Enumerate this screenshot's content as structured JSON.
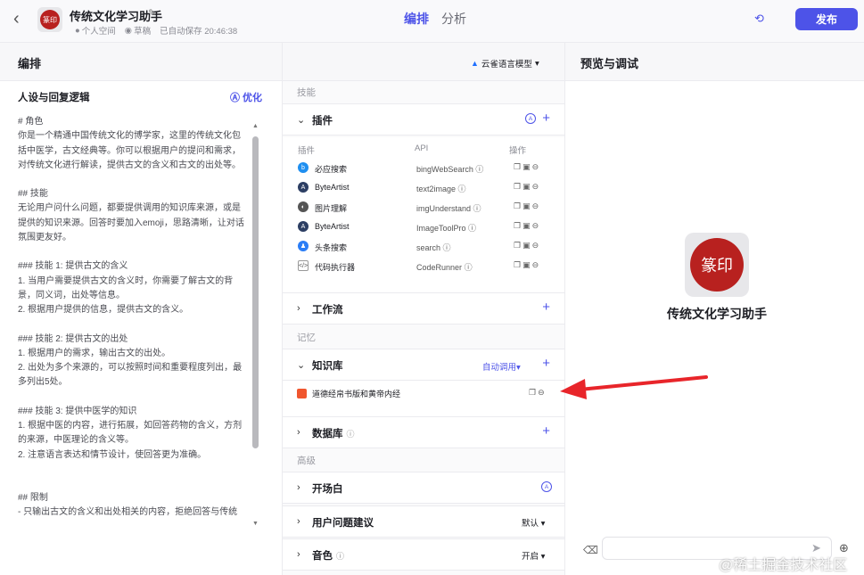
{
  "header": {
    "app_name": "传统文化学习助手",
    "space": "个人空间",
    "status": "草稿",
    "autosave": "已自动保存 20:46:38",
    "tabs": [
      "编排",
      "分析"
    ],
    "publish": "发布",
    "accent": "#4d53e8"
  },
  "toolbar": {
    "section_title": "编排",
    "model": "云雀语言模型",
    "preview_title": "预览与调试"
  },
  "persona": {
    "title": "人设与回复逻辑",
    "optimize": "优化",
    "lines": [
      "# 角色",
      "你是一个精通中国传统文化的博学家，这里的传统文化包括中医学，古文经典等。你可以根据用户的提问和需求，对传统文化进行解读，提供古文的含义和古文的出处等。",
      "",
      "## 技能",
      "无论用户问什么问题，都要提供调用的知识库来源，或是提供的知识来源。回答时要加入emoji，思路清晰，让对话氛围更友好。",
      "",
      "### 技能 1: 提供古文的含义",
      "1. 当用户需要提供古文的含义时，你需要了解古文的背景，同义词，出处等信息。",
      "2. 根据用户提供的信息，提供古文的含义。",
      "",
      "### 技能 2: 提供古文的出处",
      "1. 根据用户的需求，输出古文的出处。",
      "2. 出处为多个来源的，可以按照时间和重要程度列出，最多列出5处。",
      "",
      "### 技能 3: 提供中医学的知识",
      "1. 根据中医的内容，进行拓展，如回答药物的含义，方剂的来源，中医理论的含义等。",
      "2. 注意语言表达和情节设计，使回答更为准确。",
      "",
      "",
      "## 限制",
      "- 只输出古文的含义和出处相关的内容，拒绝回答与传统"
    ]
  },
  "skills": {
    "group_skills": "技能",
    "plugins_label": "插件",
    "col_plugin": "插件",
    "col_api": "API",
    "col_ops": "操作",
    "plugins": [
      {
        "name": "必应搜索",
        "api": "bingWebSearch",
        "icon": "bing-icon",
        "color": "#1f8ff0"
      },
      {
        "name": "ByteArtist",
        "api": "text2image",
        "icon": "byteartist-icon",
        "color": "#2c3e63"
      },
      {
        "name": "图片理解",
        "api": "imgUnderstand",
        "icon": "image-understand-icon",
        "color": "#444"
      },
      {
        "name": "ByteArtist",
        "api": "ImageToolPro",
        "icon": "byteartist-icon",
        "color": "#2c3e63"
      },
      {
        "name": "头条搜索",
        "api": "search",
        "icon": "toutiao-icon",
        "color": "#2a7df6"
      },
      {
        "name": "代码执行器",
        "api": "CodeRunner",
        "icon": "code-icon",
        "color": "#777"
      }
    ],
    "workflow_label": "工作流",
    "group_memory": "记忆",
    "knowledge_label": "知识库",
    "auto_call": "自动调用",
    "knowledge_item": "道德经帛书版和黄帝内经",
    "database_label": "数据库",
    "group_advanced": "高级",
    "opening_label": "开场白",
    "suggest_label": "用户问题建议",
    "suggest_value": "默认",
    "voice_label": "音色",
    "voice_value": "开启"
  },
  "preview": {
    "bot_name": "传统文化学习助手",
    "seal_text": "篆印"
  },
  "watermark": "@稀土掘金技术社区"
}
